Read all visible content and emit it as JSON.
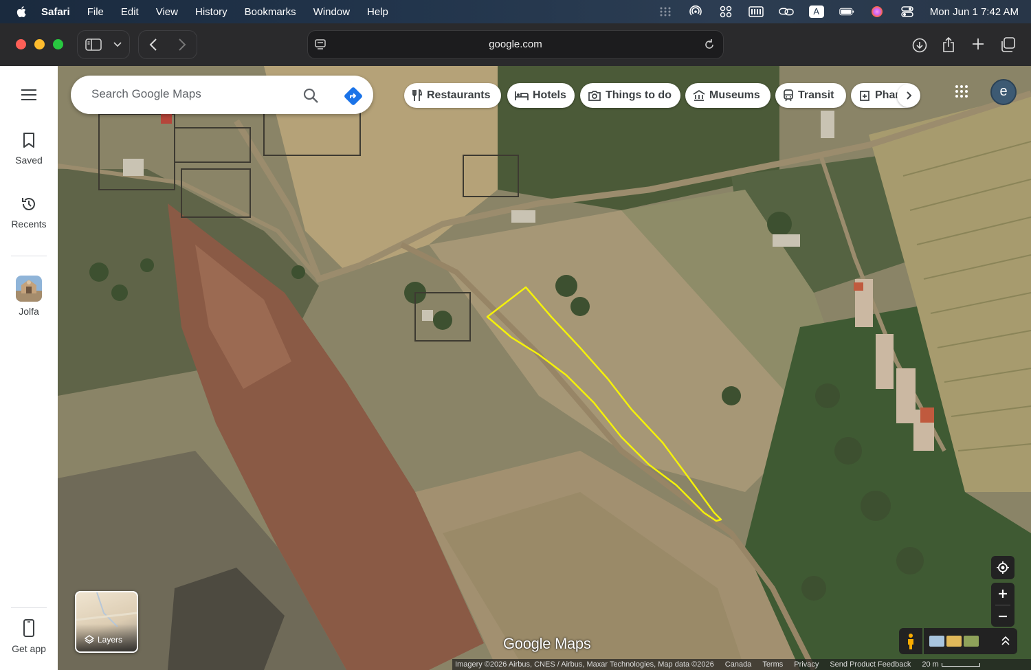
{
  "menubar": {
    "app_name": "Safari",
    "menus": [
      "File",
      "Edit",
      "View",
      "History",
      "Bookmarks",
      "Window",
      "Help"
    ],
    "clock": "Mon Jun 1  7:42 AM",
    "status_icons": [
      "grid-dots-icon",
      "airdrop-icon",
      "control-icon",
      "keyboard-icon",
      "link-icon",
      "input-source-icon",
      "battery-icon",
      "siri-icon",
      "control-center-icon"
    ],
    "input_source": "A"
  },
  "browser": {
    "url": "google.com"
  },
  "sidebar": {
    "items": [
      {
        "label": "Saved",
        "icon": "bookmark-icon"
      },
      {
        "label": "Recents",
        "icon": "history-icon"
      },
      {
        "label": "Jolfa",
        "icon": "place-thumbnail"
      },
      {
        "label": "Get app",
        "icon": "phone-icon"
      }
    ]
  },
  "search": {
    "placeholder": "Search Google Maps"
  },
  "chips": [
    {
      "label": "Restaurants",
      "icon": "restaurant-icon"
    },
    {
      "label": "Hotels",
      "icon": "hotel-icon"
    },
    {
      "label": "Things to do",
      "icon": "camera-icon"
    },
    {
      "label": "Museums",
      "icon": "museum-icon"
    },
    {
      "label": "Transit",
      "icon": "transit-icon"
    },
    {
      "label": "Phar",
      "icon": "pharmacy-icon"
    }
  ],
  "account": {
    "avatar_letter": "e"
  },
  "map": {
    "layers_label": "Layers",
    "logo": "Google Maps",
    "footer": {
      "imagery": "Imagery ©2026 Airbus, CNES / Airbus, Maxar Technologies, Map data ©2026",
      "region": "Canada",
      "terms": "Terms",
      "privacy": "Privacy",
      "feedback": "Send Product Feedback",
      "scale": "20 m"
    },
    "polygon_color": "#f4f10a"
  }
}
